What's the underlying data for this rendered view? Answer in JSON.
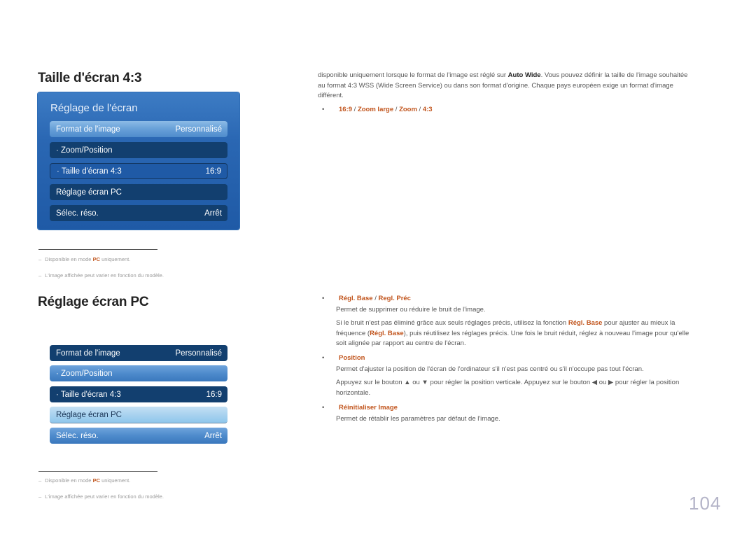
{
  "page_number": "104",
  "accent_color": "#c1541c",
  "section1": {
    "title": "Taille d'écran 4:3",
    "osd": {
      "title": "Réglage de l'écran",
      "rows": [
        {
          "label": "Format de l'image",
          "value": "Personnalisé",
          "state": "light"
        },
        {
          "label": "· Zoom/Position",
          "value": "",
          "state": "dark"
        },
        {
          "label": "· Taille d'écran 4:3",
          "value": "16:9",
          "state": "selected"
        },
        {
          "label": "Réglage écran PC",
          "value": "",
          "state": "dark"
        },
        {
          "label": "Sélec. réso.",
          "value": "Arrêt",
          "state": "dark"
        }
      ]
    },
    "footnotes": [
      {
        "before": "Disponible en mode ",
        "highlight": "PC",
        "after": " uniquement."
      },
      {
        "before": "L'image affichée peut varier en fonction du modèle.",
        "highlight": "",
        "after": ""
      }
    ]
  },
  "section2": {
    "title": "Réglage écran PC",
    "rows": [
      {
        "label": "Format de l'image",
        "value": "Personnalisé",
        "state": "dark"
      },
      {
        "label": "· Zoom/Position",
        "value": "",
        "state": "light"
      },
      {
        "label": "· Taille d'écran 4:3",
        "value": "16:9",
        "state": "dark"
      },
      {
        "label": "Réglage écran PC",
        "value": "",
        "state": "selected"
      },
      {
        "label": "Sélec. réso.",
        "value": "Arrêt",
        "state": "light"
      }
    ],
    "footnotes": [
      {
        "before": "Disponible en mode ",
        "highlight": "PC",
        "after": " uniquement."
      },
      {
        "before": "L'image affichée peut varier en fonction du modèle.",
        "highlight": "",
        "after": ""
      }
    ]
  },
  "right": {
    "intro": {
      "line1_before": "disponible uniquement lorsque le format de l'image est réglé sur ",
      "line1_bold": "Auto Wide",
      "line1_after": ". Vous pouvez définir la taille de l'image souhaitée",
      "line2": "au format 4:3 WSS (Wide Screen Service) ou dans son format d'origine. Chaque pays européen exige un format d'image",
      "line3": "différent."
    },
    "options_bullet": {
      "items": [
        "16:9",
        "Zoom large",
        "Zoom",
        "4:3"
      ],
      "separator": " / "
    },
    "bullets": [
      {
        "title_parts": [
          "Régl. Base",
          "Regl. Préc"
        ],
        "lines": [
          "Permet de supprimer ou réduire le bruit de l'image."
        ],
        "detail": {
          "l1_before": "Si le bruit n'est pas éliminé grâce aux seuls réglages précis, utilisez la fonction ",
          "l1_accent": "Régl. Base",
          "l1_after": " pour ajuster au mieux la",
          "l2_before": "fréquence (",
          "l2_accent": "Régl. Base",
          "l2_after": "), puis réutilisez les réglages précis. Une fois le bruit réduit, réglez à nouveau l'image pour qu'elle",
          "l3": "soit alignée par rapport au centre de l'écran."
        }
      },
      {
        "title": "Position",
        "line1": "Permet d'ajuster la position de l'écran de l'ordinateur s'il n'est pas centré ou s'il n'occupe pas tout l'écran.",
        "line2": "Appuyez sur le bouton ▲ ou ▼ pour régler la position verticale. Appuyez sur le bouton ◀ ou ▶ pour régler la position",
        "line3": "horizontale."
      },
      {
        "title": "Réinitialiser Image",
        "line1": "Permet de rétablir les paramètres par défaut de l'image."
      }
    ]
  }
}
